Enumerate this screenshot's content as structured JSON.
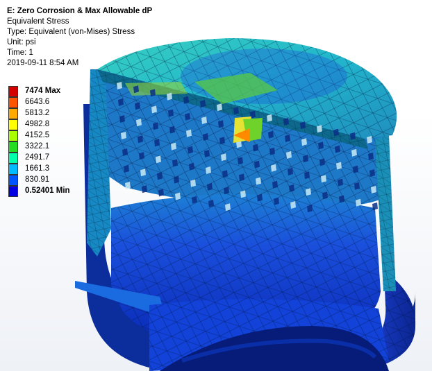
{
  "header": {
    "title": "E: Zero Corrosion & Max Allowable dP",
    "result_type": "Equivalent Stress",
    "type_line": "Type: Equivalent (von-Mises) Stress",
    "unit_line": "Unit: psi",
    "time_line": "Time: 1",
    "timestamp": "2019-09-11 8:54 AM"
  },
  "legend": {
    "entries": [
      {
        "label": "7474 Max",
        "color": "#d40000",
        "bold": true
      },
      {
        "label": "6643.6",
        "color": "#ff5500",
        "bold": false
      },
      {
        "label": "5813.2",
        "color": "#ffaa00",
        "bold": false
      },
      {
        "label": "4982.8",
        "color": "#ffff00",
        "bold": false
      },
      {
        "label": "4152.5",
        "color": "#aaff00",
        "bold": false
      },
      {
        "label": "3322.1",
        "color": "#22dd22",
        "bold": false
      },
      {
        "label": "2491.7",
        "color": "#00ffaa",
        "bold": false
      },
      {
        "label": "1661.3",
        "color": "#00bbff",
        "bold": false
      },
      {
        "label": "830.91",
        "color": "#0055ff",
        "bold": false
      },
      {
        "label": "0.52401 Min",
        "color": "#0000e0",
        "bold": true
      }
    ]
  },
  "model": {
    "palette": {
      "shell_dark": "#0a1f8a",
      "shell_mid": "#1538c8",
      "shell_light": "#2a66e6",
      "lid_cyan": "#28c8d4",
      "lid_teal": "#1aa8b8",
      "hotspot_green": "#6fd22a",
      "hotspot_yellow": "#e6e233",
      "bore_deep": "#061c78"
    }
  }
}
